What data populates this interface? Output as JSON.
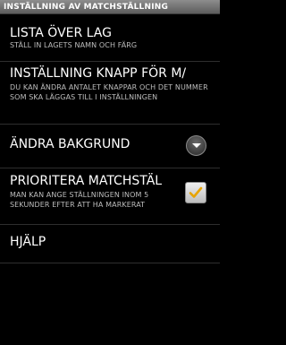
{
  "titlebar": {
    "title": "INSTÄLLNING AV MATCHSTÄLLNING"
  },
  "preferences": [
    {
      "title": "LISTA ÖVER LAG",
      "summary": "STÄLL IN LAGETS NAMN OCH FÄRG"
    },
    {
      "title": "INSTÄLLNING KNAPP FÖR M/",
      "summary": "DU KAN ÄNDRA ANTALET KNAPPAR OCH DET NUMMER SOM SKA LÄGGAS TILL I INSTÄLLNINGEN"
    },
    {
      "title": "ÄNDRA BAKGRUND",
      "widget": "dropdown-icon"
    },
    {
      "title": "PRIORITERA MATCHSTÄL",
      "summary": "MAN KAN ANGE STÄLLNINGEN INOM 5 SEKUNDER EFTER ATT HA MARKERAT",
      "widget": "checkbox",
      "checked": true
    },
    {
      "title": "HJÄLP"
    }
  ],
  "colors": {
    "background": "#000000",
    "summary_text": "#bdbdbd",
    "checkmark": "#e8a400"
  }
}
